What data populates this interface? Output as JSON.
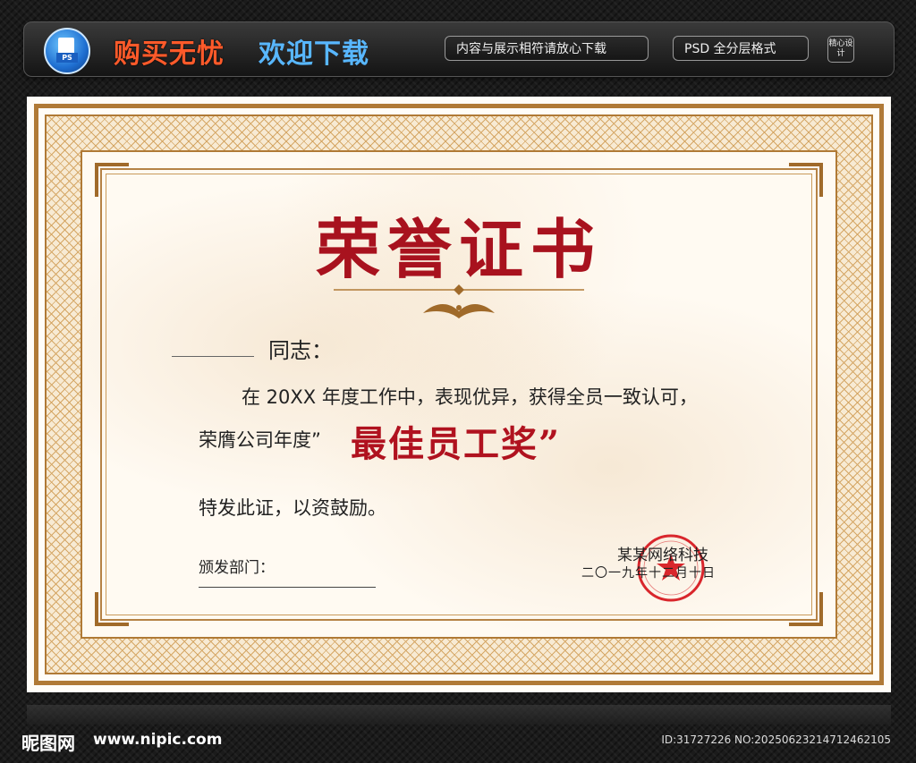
{
  "banner": {
    "icon": "ps-file-icon",
    "icon_tag": "PS",
    "slogan_primary": "购买无忧",
    "slogan_secondary": "欢迎下载",
    "notice": "内容与展示相符请放心下载",
    "format": "PSD 全分层格式",
    "badge": "精心设计"
  },
  "certificate": {
    "title": "荣誉证书",
    "addressee_suffix": "同志：",
    "body_line1": "在 20XX 年度工作中，表现优异，获得全员一致认可，",
    "body_line2_prefix": "荣膺公司年度”",
    "award_name": "最佳员工奖”",
    "body_line3": "特发此证，以资鼓励。",
    "issuer_label": "颁发部门：",
    "company": "某某网络科技",
    "date": "二〇一九年十二月十日",
    "seal_color": "#d9262c",
    "title_color": "#a8121e",
    "frame_color": "#b07a36"
  },
  "footer": {
    "site_logo": "昵图网",
    "url": "www.nipic.com",
    "id_info": "ID:31727226 NO:20250623214712462105"
  }
}
